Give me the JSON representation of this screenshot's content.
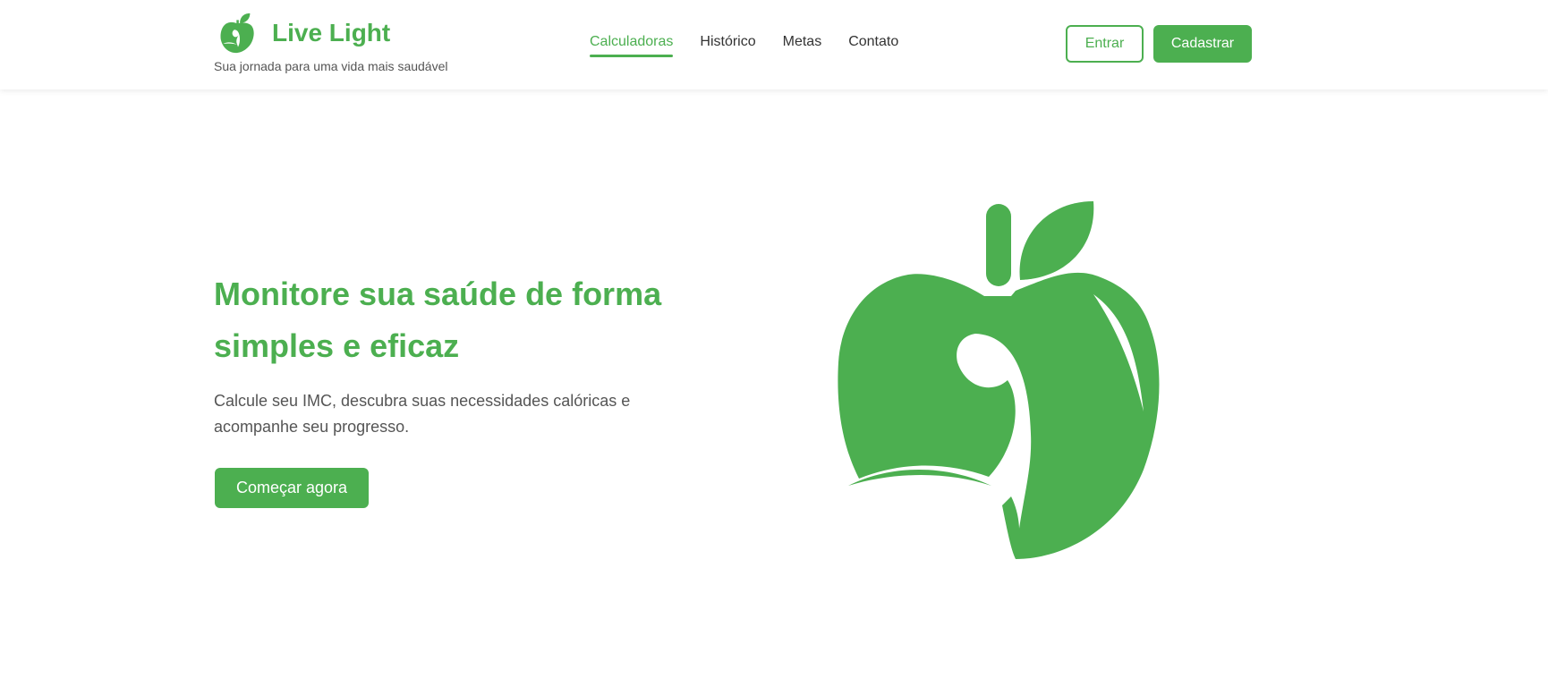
{
  "header": {
    "brand_name": "Live Light",
    "tagline": "Sua jornada para uma vida mais saudável",
    "logo_icon": "apple-leaf-icon"
  },
  "nav": {
    "items": [
      {
        "label": "Calculadoras",
        "active": true
      },
      {
        "label": "Histórico",
        "active": false
      },
      {
        "label": "Metas",
        "active": false
      },
      {
        "label": "Contato",
        "active": false
      }
    ]
  },
  "auth": {
    "login_label": "Entrar",
    "signup_label": "Cadastrar"
  },
  "hero": {
    "title": "Monitore sua saúde de forma simples e eficaz",
    "description": "Calcule seu IMC, descubra suas necessidades calóricas e acompanhe seu progresso.",
    "cta_label": "Começar agora",
    "illustration_icon": "apple-icon"
  },
  "colors": {
    "primary": "#4caf50",
    "text": "#333333",
    "muted": "#555555",
    "background": "#ffffff"
  }
}
